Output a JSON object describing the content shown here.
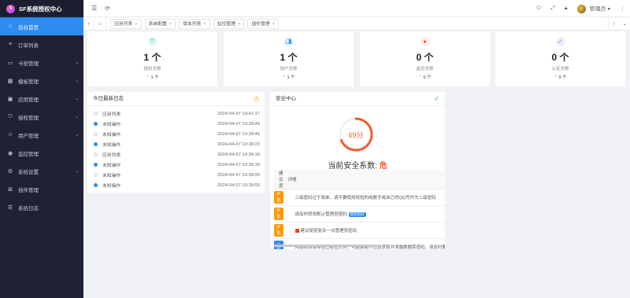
{
  "brand": {
    "title": "SF系统授权中心"
  },
  "sidebar": {
    "items": [
      {
        "label": "后台首页",
        "icon": "home-icon",
        "active": true,
        "chevron": false
      },
      {
        "label": "订单列表",
        "icon": "list-icon",
        "active": false,
        "chevron": false
      },
      {
        "label": "卡密管理",
        "icon": "card-icon",
        "active": false,
        "chevron": true
      },
      {
        "label": "模板管理",
        "icon": "template-icon",
        "active": false,
        "chevron": true
      },
      {
        "label": "应用管理",
        "icon": "app-icon",
        "active": false,
        "chevron": true
      },
      {
        "label": "授权管理",
        "icon": "shield-icon",
        "active": false,
        "chevron": true
      },
      {
        "label": "用户管理",
        "icon": "user-icon",
        "active": false,
        "chevron": true
      },
      {
        "label": "监控管理",
        "icon": "monitor-icon",
        "active": false,
        "chevron": false
      },
      {
        "label": "系统设置",
        "icon": "gear-icon",
        "active": false,
        "chevron": true
      },
      {
        "label": "插件管理",
        "icon": "plugin-icon",
        "active": false,
        "chevron": false
      },
      {
        "label": "系统日志",
        "icon": "log-icon",
        "active": false,
        "chevron": false
      }
    ]
  },
  "topbar": {
    "user_name": "管理员",
    "dropdown_glyph": "▾"
  },
  "tabs": [
    {
      "label": "应用列表"
    },
    {
      "label": "系统配置"
    },
    {
      "label": "版本列表"
    },
    {
      "label": "监控管理"
    },
    {
      "label": "插件管理"
    }
  ],
  "stats": [
    {
      "value": "1 个",
      "label": "授权总数",
      "trend": "1 个",
      "icon_color": "#19be6b",
      "icon_bg": "#e8f8ef",
      "icon": "shield-check-icon"
    },
    {
      "value": "1 个",
      "label": "用户总数",
      "trend": "1 个",
      "icon_color": "#2d8cf0",
      "icon_bg": "#e6f2fe",
      "icon": "users-icon"
    },
    {
      "value": "0 个",
      "label": "监控总数",
      "trend": "0 个",
      "icon_color": "#ed4014",
      "icon_bg": "#fdeceb",
      "icon": "monitor-dot-icon"
    },
    {
      "value": "0 个",
      "label": "认证总数",
      "trend": "0 个",
      "icon_color": "#9b59e8",
      "icon_bg": "#f2eafc",
      "icon": "verify-icon"
    }
  ],
  "log": {
    "title": "今日最新日志",
    "rows": [
      {
        "text": "应用列表",
        "time": "2024-04-07 10:41:17",
        "filled": false
      },
      {
        "text": "未知操作",
        "time": "2024-04-07 10:39:45",
        "filled": true
      },
      {
        "text": "未知操作",
        "time": "2024-04-07 10:39:45",
        "filled": false
      },
      {
        "text": "未知操作",
        "time": "2024-04-07 10:39:23",
        "filled": true
      },
      {
        "text": "应用列表",
        "time": "2024-04-07 10:39:16",
        "filled": false
      },
      {
        "text": "未知操作",
        "time": "2024-04-07 10:39:16",
        "filled": true
      },
      {
        "text": "未知操作",
        "time": "2024-04-07 10:39:00",
        "filled": false
      },
      {
        "text": "未知操作",
        "time": "2024-04-07 10:39:00",
        "filled": true
      }
    ]
  },
  "security": {
    "title": "安全中心",
    "score_text": "69分",
    "score_fraction": 0.69,
    "headline_prefix": "当前安全系数:",
    "headline_level": "危",
    "col_level": "建议度",
    "col_detail": "详情",
    "rows": [
      {
        "badge": "严重",
        "badge_type": "warn",
        "detail": "二级密码过于简单，请不要使用较短的纯数字或自己的QQ号作为二级密码",
        "button": "",
        "warn_icon": false
      },
      {
        "badge": "严重",
        "badge_type": "warn",
        "detail": "请及时修改默认管理员密码",
        "button": "修改密码",
        "warn_icon": false
      },
      {
        "badge": "严重",
        "badge_type": "warn",
        "detail": "建议使用复杂一点管理员密码",
        "button": "",
        "warn_icon": true
      },
      {
        "badge": "一般",
        "badge_type": "info",
        "detail": "网站根目录存在压缩包文件，可能会被人恶意获取并泄露数据库密码，请及时删除",
        "button": "",
        "warn_icon": false
      }
    ]
  }
}
